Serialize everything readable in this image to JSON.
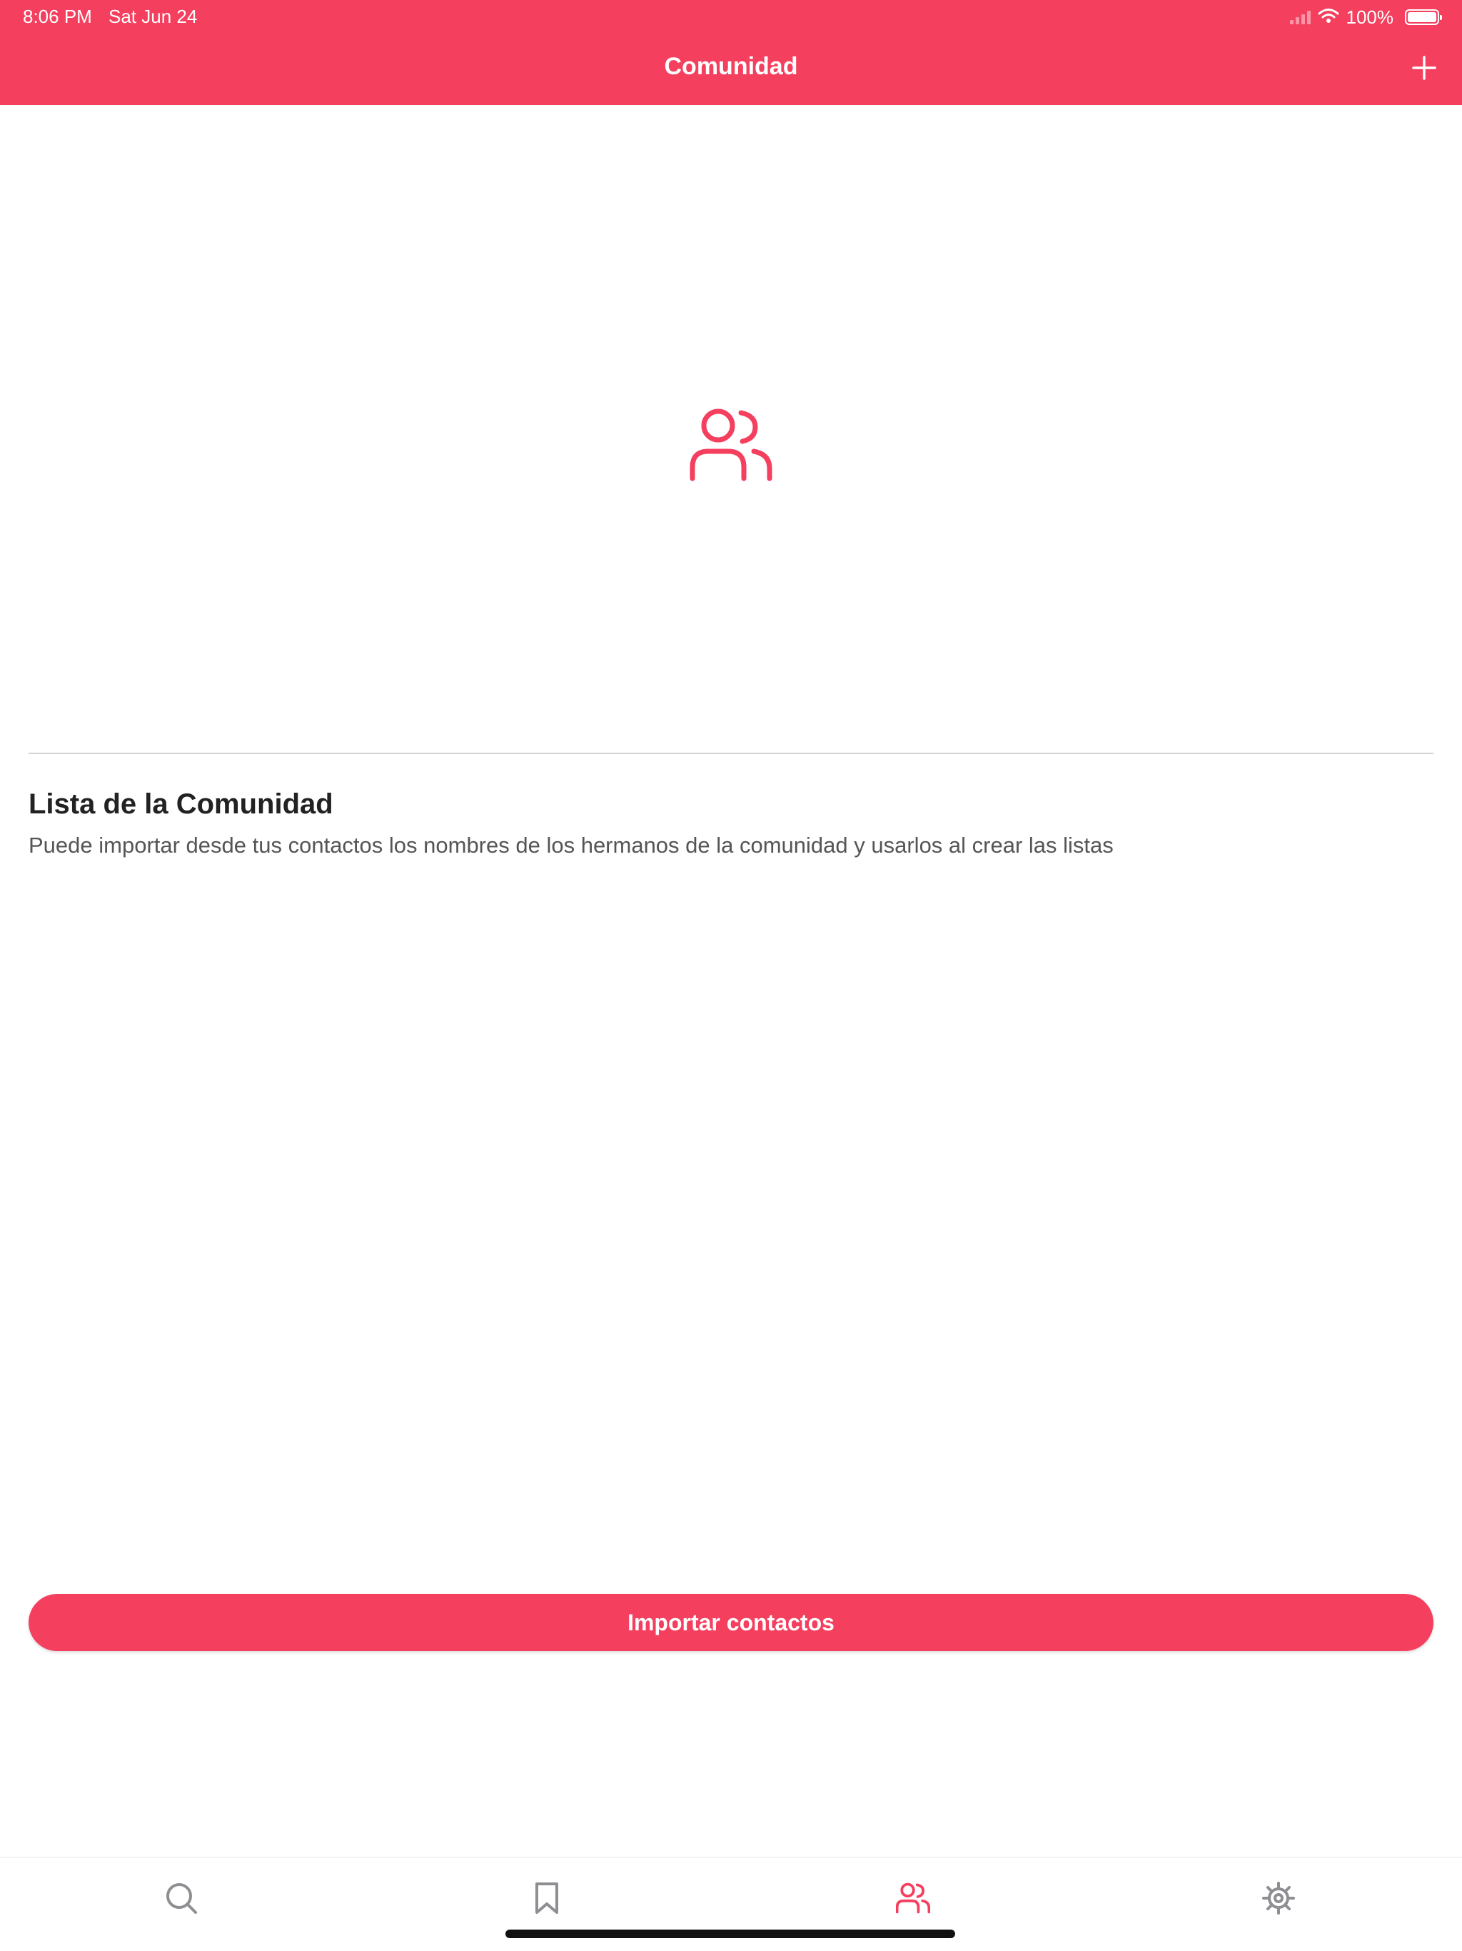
{
  "status_bar": {
    "time": "8:06 PM",
    "date": "Sat Jun 24",
    "battery": "100%"
  },
  "nav": {
    "title": "Comunidad",
    "add_icon": "plus-icon"
  },
  "empty_state": {
    "icon": "people-icon",
    "title": "Lista de la Comunidad",
    "description": "Puede importar desde tus contactos los nombres de los hermanos de la comunidad y usarlos al crear las listas"
  },
  "actions": {
    "import_label": "Importar contactos"
  },
  "tabs": [
    {
      "icon": "search-icon",
      "active": false
    },
    {
      "icon": "bookmark-icon",
      "active": false
    },
    {
      "icon": "people-icon",
      "active": true
    },
    {
      "icon": "gear-icon",
      "active": false
    }
  ],
  "colors": {
    "accent": "#f43f5e",
    "inactive_icon": "#8e8e93"
  }
}
